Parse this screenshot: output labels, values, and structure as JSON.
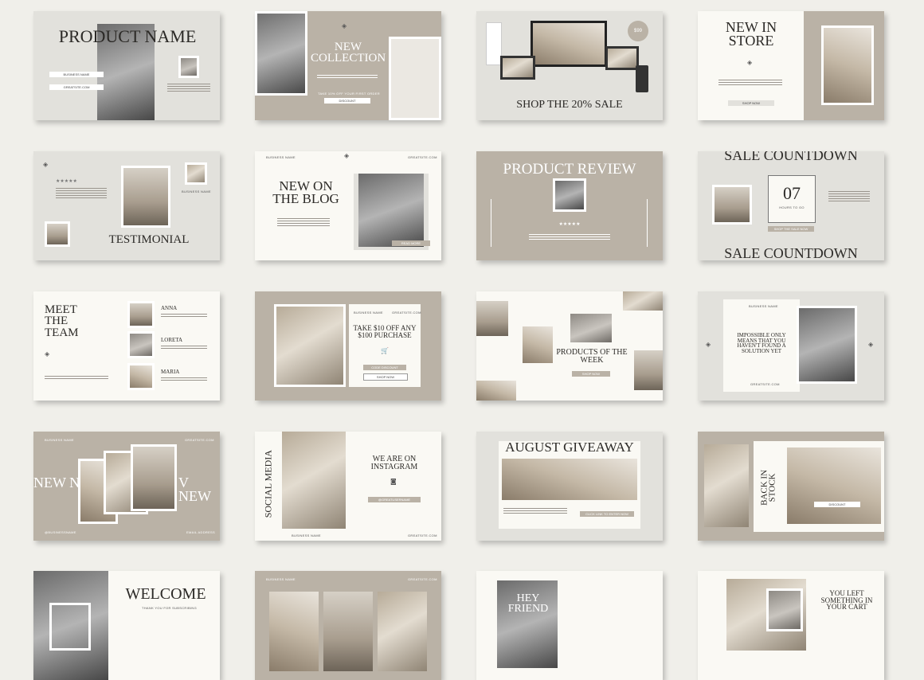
{
  "slides": {
    "s1": {
      "title": "PRODUCT NAME",
      "field1": "BUSINESS NAME",
      "field2": "GREATSITE.COM"
    },
    "s2": {
      "title": "NEW COLLECTION",
      "cta": "TAKE 10% OFF YOUR FIRST ORDER",
      "button": "DISCOUNT"
    },
    "s3": {
      "title": "SHOP THE 20% SALE",
      "badge": "$99"
    },
    "s4": {
      "title": "NEW IN STORE",
      "button": "SHOP NOW"
    },
    "s5": {
      "title": "TESTIMONIAL",
      "stars": "★★★★★",
      "label": "BUSINESS NAME"
    },
    "s6": {
      "title": "NEW ON THE BLOG",
      "header_left": "BUSINESS NAME",
      "header_right": "GREATSITE.COM",
      "button": "READ MORE"
    },
    "s7": {
      "title": "PRODUCT REVIEW",
      "stars": "★★★★★"
    },
    "s8": {
      "title_top": "SALE COUNTDOWN",
      "title_bottom": "SALE COUNTDOWN",
      "number": "07",
      "unit": "HOURS TO GO",
      "button": "SHOP THE SALE NOW"
    },
    "s9": {
      "title": "MEET THE TEAM",
      "members": [
        "ANNA",
        "LORETA",
        "MARIA"
      ]
    },
    "s10": {
      "title": "TAKE $10 OFF ANY $100 PURCHASE",
      "header_left": "BUSINESS NAME",
      "header_right": "GREATSITE.COM",
      "button1": "CODE DISCOUNT",
      "button2": "SHOP NOW"
    },
    "s11": {
      "title": "PRODUCTS OF THE WEEK",
      "button": "SHOP NOW"
    },
    "s12": {
      "title": "IMPOSSIBLE ONLY MEANS THAT YOU HAVEN'T FOUND A SOLUTION YET",
      "label_top": "BUSINESS NAME",
      "label_bottom": "GREATSITE.COM"
    },
    "s13": {
      "text_left": "NEW N",
      "text_right": "V NEW",
      "header_left": "BUSINESS NAME",
      "header_right": "GREATSITE.COM",
      "footer_left": "@BUSINESSNAME",
      "footer_right": "EMAIL ADDRESS"
    },
    "s14": {
      "side": "SOCIAL MEDIA",
      "title": "WE ARE ON INSTAGRAM",
      "handle": "@GREATUSERNAME",
      "footer_left": "BUSINESS NAME",
      "footer_right": "GREATSITE.COM"
    },
    "s15": {
      "title": "AUGUST GIVEAWAY",
      "button": "CLICK LINK TO ENTER NOW"
    },
    "s16": {
      "side": "BACK IN STOCK",
      "button": "DISCOUNT"
    },
    "s17": {
      "title": "WELCOME",
      "subtitle": "THANK YOU FOR SUBSCRIBING"
    },
    "s18": {
      "header_left": "BUSINESS NAME",
      "header_right": "GREATSITE.COM"
    },
    "s19": {
      "title": "HEY FRIEND"
    },
    "s20": {
      "title": "YOU LEFT SOMETHING IN YOUR CART"
    }
  },
  "colors": {
    "background": "#f0efea",
    "light": "#e2e1dc",
    "cream": "#faf9f4",
    "taupe": "#bab2a6"
  }
}
